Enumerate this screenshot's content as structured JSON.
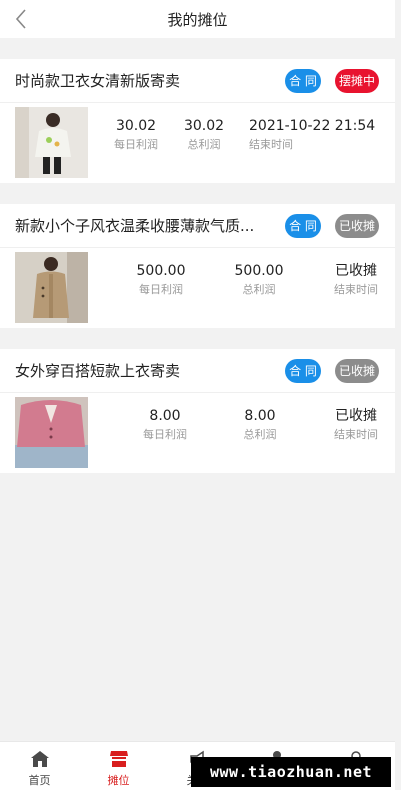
{
  "header": {
    "title": "我的摊位"
  },
  "stalls": [
    {
      "title": "时尚款卫衣女清新版寄卖",
      "contract_label": "合 同",
      "status_label": "摆摊中",
      "status": "active",
      "daily_profit": "30.02",
      "daily_profit_label": "每日利润",
      "total_profit": "30.02",
      "total_profit_label": "总利润",
      "end_time": "2021-10-22 21:54",
      "end_time_label": "结束时间"
    },
    {
      "title": "新款小个子风衣温柔收腰薄款气质...",
      "contract_label": "合 同",
      "status_label": "已收摊",
      "status": "closed",
      "daily_profit": "500.00",
      "daily_profit_label": "每日利润",
      "total_profit": "500.00",
      "total_profit_label": "总利润",
      "end_time": "已收摊",
      "end_time_label": "结束时间"
    },
    {
      "title": "女外穿百搭短款上衣寄卖",
      "contract_label": "合 同",
      "status_label": "已收摊",
      "status": "closed",
      "daily_profit": "8.00",
      "daily_profit_label": "每日利润",
      "total_profit": "8.00",
      "total_profit_label": "总利润",
      "end_time": "已收摊",
      "end_time_label": "结束时间"
    }
  ],
  "tabbar": {
    "items": [
      {
        "label": "首页",
        "icon": "home-icon"
      },
      {
        "label": "摊位",
        "icon": "stall-icon",
        "active": true
      },
      {
        "label": "关于",
        "icon": "megaphone-icon"
      },
      {
        "label": "",
        "icon": "dot-icon"
      },
      {
        "label": "",
        "icon": "user-icon"
      }
    ]
  },
  "watermark": "www.tiaozhuan.net",
  "colors": {
    "accent_red": "#d81e1e",
    "badge_blue": "#1a8fe8",
    "badge_red": "#e8132f",
    "badge_gray": "#8c8c8c"
  }
}
